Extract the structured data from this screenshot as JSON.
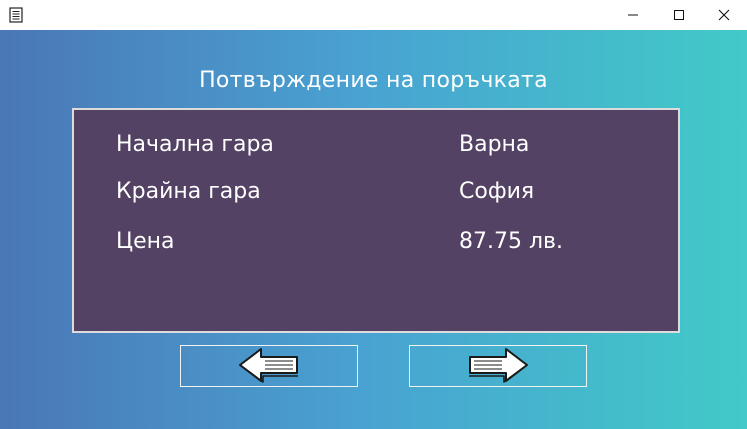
{
  "window": {
    "icon": "document-icon",
    "controls": [
      "minimize-icon",
      "maximize-icon",
      "close-icon"
    ]
  },
  "page": {
    "title": "Потвърждение на поръчката"
  },
  "order": {
    "rows": [
      {
        "label": "Начална гара",
        "value": "Варна"
      },
      {
        "label": "Крайна гара",
        "value": "София"
      },
      {
        "label": "Цена",
        "value": "87.75 лв."
      }
    ]
  },
  "navigation": {
    "back_icon": "left-arrow-icon",
    "forward_icon": "right-arrow-icon"
  },
  "colors": {
    "gradient_start": "#4a77b6",
    "gradient_mid": "#49a2d2",
    "gradient_end": "#41cac7",
    "panel_background": "#534263",
    "panel_border": "#dcdcdc",
    "text": "#ffffff"
  }
}
